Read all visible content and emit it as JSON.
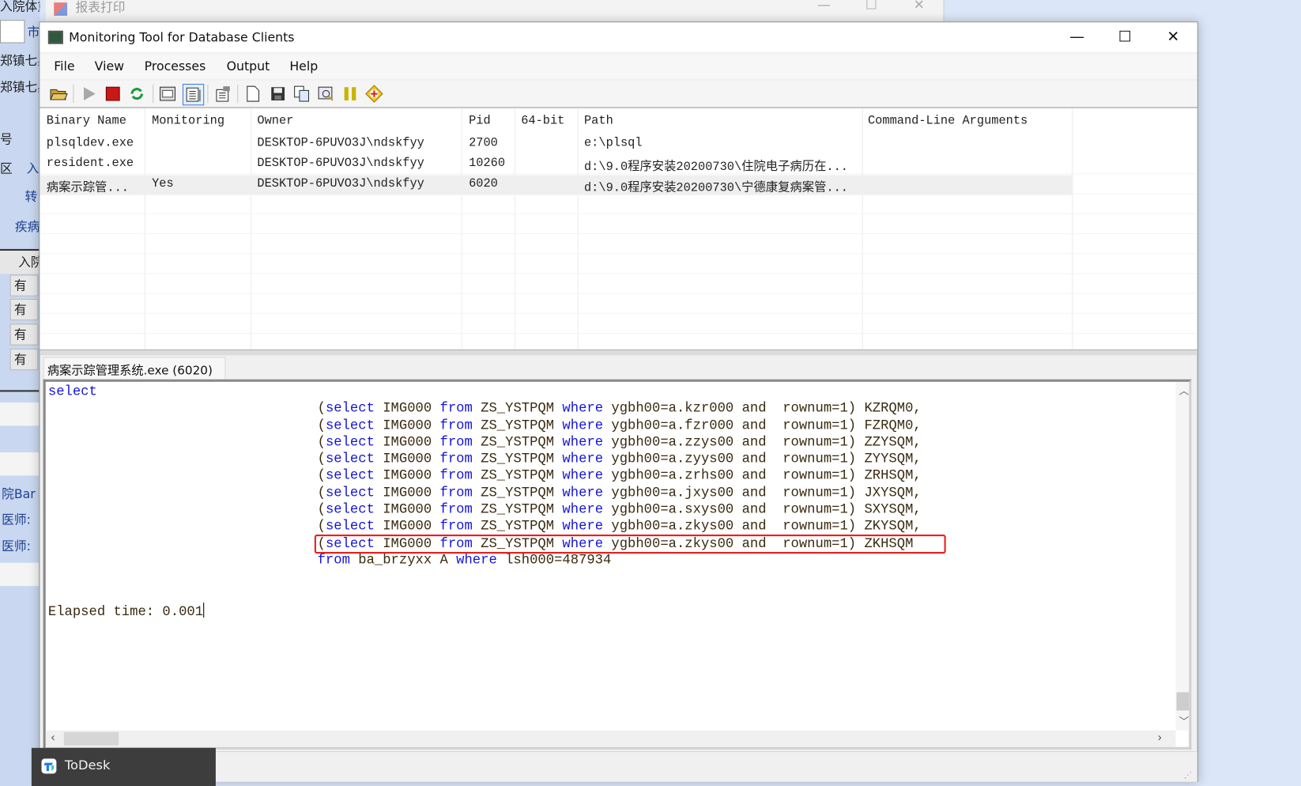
{
  "background_app": {
    "fragments": [
      "入院体重",
      "市",
      "郑镇七星",
      "郑镇七星",
      "号",
      "区",
      "入",
      "转",
      "疾病",
      "入院",
      "院Bar",
      "医师:",
      "医师:"
    ],
    "cells": [
      "有",
      "有",
      "有",
      "有"
    ]
  },
  "back_window": {
    "title": "报表打印"
  },
  "window": {
    "title": "Monitoring Tool for Database Clients",
    "controls": {
      "minimize": "—",
      "maximize": "☐",
      "close": "✕"
    }
  },
  "menu": [
    "File",
    "View",
    "Processes",
    "Output",
    "Help"
  ],
  "toolbar": [
    "open-icon",
    "run-icon",
    "stop-icon",
    "refresh-icon",
    "view-hex-icon",
    "view-text-icon",
    "properties-icon",
    "new-icon",
    "save-icon",
    "copy-icon",
    "find-icon",
    "pause-icon",
    "debug-icon"
  ],
  "table": {
    "columns": [
      "Binary Name",
      "Monitoring",
      "Owner",
      "Pid",
      "64-bit",
      "Path",
      "Command-Line Arguments"
    ],
    "rows": [
      [
        "plsqldev.exe",
        "",
        "DESKTOP-6PUVO3J\\ndskfyy",
        "2700",
        "",
        "e:\\plsql",
        ""
      ],
      [
        "resident.exe",
        "",
        "DESKTOP-6PUVO3J\\ndskfyy",
        "10260",
        "",
        "d:\\9.0程序安装20200730\\住院电子病历在...",
        ""
      ],
      [
        "病案示踪管...",
        "Yes",
        "DESKTOP-6PUVO3J\\ndskfyy",
        "6020",
        "",
        "d:\\9.0程序安装20200730\\宁德康复病案管...",
        ""
      ]
    ],
    "selected_row": 2
  },
  "output_tab": {
    "label": "病案示踪管理系统.exe (6020)"
  },
  "sql": {
    "lines": [
      "select",
      "                                 (select IMG000 from ZS_YSTPQM where ygbh00=a.kzr000 and  rownum=1) KZRQM0,",
      "                                 (select IMG000 from ZS_YSTPQM where ygbh00=a.fzr000 and  rownum=1) FZRQM0,",
      "                                 (select IMG000 from ZS_YSTPQM where ygbh00=a.zzys00 and  rownum=1) ZZYSQM,",
      "                                 (select IMG000 from ZS_YSTPQM where ygbh00=a.zyys00 and  rownum=1) ZYYSQM,",
      "                                 (select IMG000 from ZS_YSTPQM where ygbh00=a.zrhs00 and  rownum=1) ZRHSQM,",
      "                                 (select IMG000 from ZS_YSTPQM where ygbh00=a.jxys00 and  rownum=1) JXYSQM,",
      "                                 (select IMG000 from ZS_YSTPQM where ygbh00=a.sxys00 and  rownum=1) SXYSQM,",
      "                                 (select IMG000 from ZS_YSTPQM where ygbh00=a.zkys00 and  rownum=1) ZKYSQM,",
      "                                 (select IMG000 from ZS_YSTPQM where ygbh00=a.zkys00 and  rownum=1) ZKHSQM",
      "                                 from ba_brzyxx A where lsh000=487934",
      "",
      "",
      "Elapsed time: 0.001"
    ],
    "keywords": [
      "select",
      "from",
      "where"
    ],
    "highlighted_line": 9,
    "keyword_color": "#1515d8",
    "highlight_color": "#e8201c"
  },
  "taskbar_popup": {
    "label": "ToDesk"
  }
}
